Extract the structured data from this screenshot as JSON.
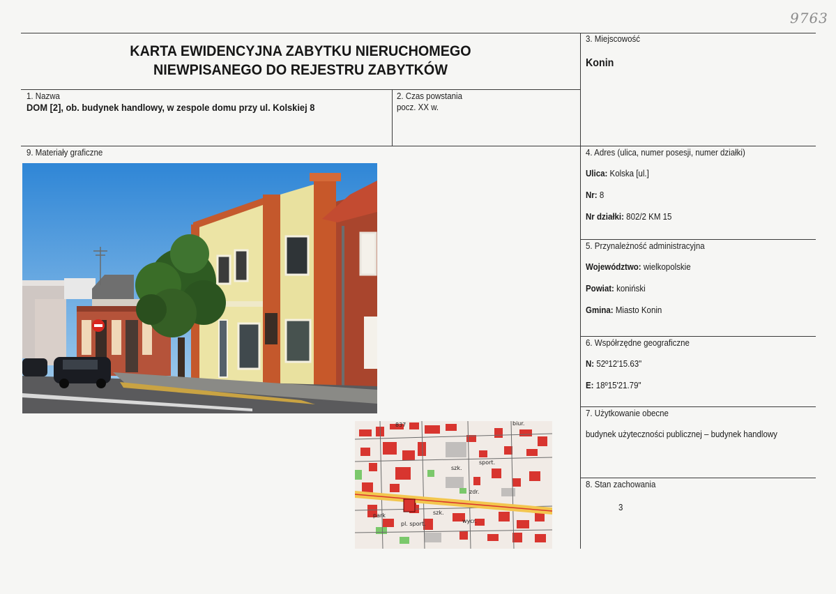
{
  "handwritten_number": "9763",
  "title": {
    "line1": "KARTA EWIDENCYJNA ZABYTKU NIERUCHOMEGO",
    "line2": "NIEWPISANEGO DO REJESTRU ZABYTKÓW"
  },
  "section1": {
    "label": "1. Nazwa",
    "value": "DOM [2], ob. budynek handlowy, w zespole domu przy ul. Kolskiej 8"
  },
  "section2": {
    "label": "2. Czas powstania",
    "value": "pocz. XX w."
  },
  "section3": {
    "label": "3. Miejscowość",
    "value": "Konin"
  },
  "section4": {
    "label": "4. Adres (ulica, numer posesji, numer działki)",
    "street_key": "Ulica:",
    "street_val": "Kolska [ul.]",
    "nr_key": "Nr:",
    "nr_val": "8",
    "plot_key": "Nr działki:",
    "plot_val": "802/2 KM 15"
  },
  "section5": {
    "label": "5. Przynależność administracyjna",
    "voiv_key": "Województwo:",
    "voiv_val": "wielkopolskie",
    "county_key": "Powiat:",
    "county_val": "koniński",
    "commune_key": "Gmina:",
    "commune_val": "Miasto Konin"
  },
  "section6": {
    "label": "6. Współrzędne geograficzne",
    "n_key": "N:",
    "n_val": "52º12'15.63\"",
    "e_key": "E:",
    "e_val": "18º15'21.79\""
  },
  "section7": {
    "label": "7. Użytkowanie obecne",
    "value": "budynek użyteczności publicznej – budynek handlowy"
  },
  "section8": {
    "label": "8. Stan zachowania",
    "value": "3"
  },
  "section9": {
    "label": "9. Materiały graficzne"
  },
  "map_labels": {
    "top": "837",
    "biur": "biur.",
    "sport": "sport.",
    "szk1": "szk.",
    "zdr": "zdr.",
    "park": "park",
    "wycr": "wycr.",
    "szk2": "szk.",
    "plsport": "pl. sport."
  },
  "colors": {
    "rule": "#3a3a3a",
    "sky": "#3f8fd8",
    "building_yellow": "#e7df9f",
    "pilaster_orange": "#c4582c",
    "brick": "#a9452d"
  }
}
